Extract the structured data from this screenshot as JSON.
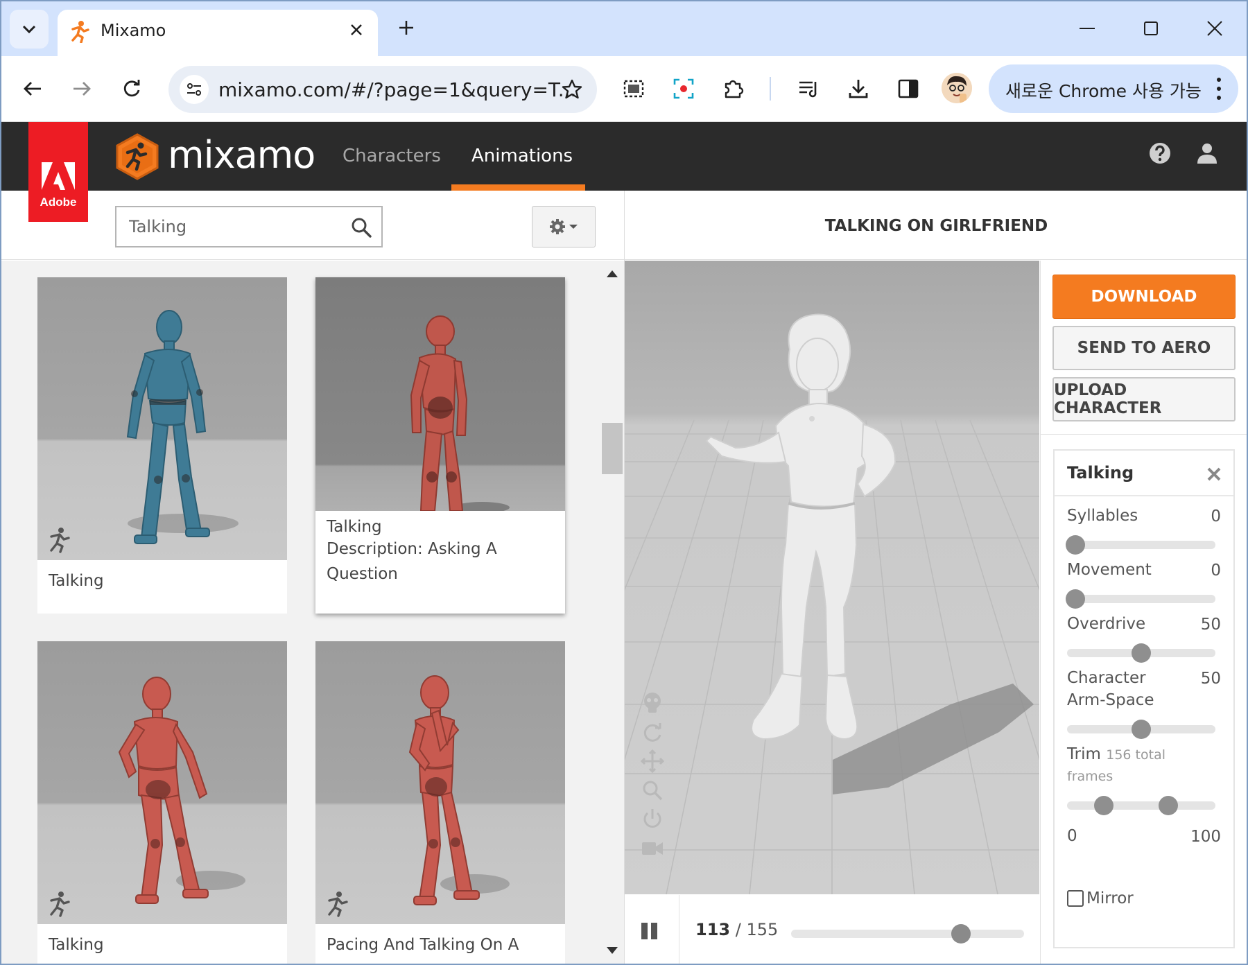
{
  "browser": {
    "tab_title": "Mixamo",
    "url": "mixamo.com/#/?page=1&query=T...",
    "update_pill": "새로운 Chrome 사용 가능",
    "icons": [
      "tab-search-icon",
      "tab-close-icon",
      "new-tab-icon",
      "minimize-icon",
      "maximize-icon",
      "window-close-icon",
      "back-icon",
      "forward-icon",
      "reload-icon",
      "site-settings-icon",
      "bookmark-star-icon",
      "screenshot-icon",
      "record-icon",
      "extensions-icon",
      "reading-list-icon",
      "download-icon",
      "side-panel-icon",
      "profile-avatar",
      "menu-icon"
    ]
  },
  "header": {
    "adobe_label": "Adobe",
    "logo_text": "mixamo",
    "nav": {
      "characters": "Characters",
      "animations": "Animations"
    },
    "active_nav": "Animations",
    "accent_color": "#f47b20",
    "icons": [
      "help-icon",
      "account-icon"
    ]
  },
  "search": {
    "value": "Talking",
    "placeholder": "Search"
  },
  "results": [
    {
      "title": "Talking",
      "description": "",
      "figure_color": "#3f7b95"
    },
    {
      "title": "Talking",
      "description": "Description: Asking A Question",
      "figure_color": "#c0574c",
      "selected": true
    },
    {
      "title": "Talking",
      "description": "",
      "figure_color": "#c85a50"
    },
    {
      "title": "Pacing And Talking On A",
      "description": "",
      "figure_color": "#c85a50"
    }
  ],
  "viewer": {
    "title": "TALKING ON GIRLFRIEND",
    "frame_current": "113",
    "frame_separator": " / ",
    "frame_total": "155",
    "playback_progress": 0.728,
    "tools": [
      "skeleton-icon",
      "orbit-icon",
      "pan-icon",
      "zoom-icon",
      "reset-icon",
      "camera-icon"
    ]
  },
  "actions": {
    "download": "DOWNLOAD",
    "send_to_aero": "SEND TO AERO",
    "upload_character": "UPLOAD CHARACTER"
  },
  "params": {
    "title": "Talking",
    "syllables": {
      "label": "Syllables",
      "value": "0"
    },
    "movement": {
      "label": "Movement",
      "value": "0"
    },
    "overdrive": {
      "label": "Overdrive",
      "value": "50"
    },
    "arm_space": {
      "label_1": "Character",
      "label_2": "Arm-Space",
      "value": "50"
    },
    "trim": {
      "label": "Trim",
      "total": "156 total",
      "frames_word": "frames",
      "min": "0",
      "max": "100"
    },
    "mirror": {
      "label": "Mirror",
      "checked": false
    }
  }
}
